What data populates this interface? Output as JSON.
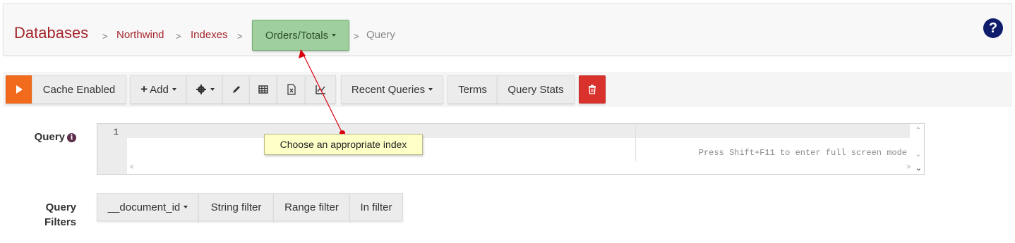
{
  "breadcrumb": {
    "databases": "Databases",
    "sep": ">",
    "database": "Northwind",
    "indexes": "Indexes",
    "index": "Orders/Totals",
    "query": "Query"
  },
  "help_icon": "question-circle-icon",
  "toolbar": {
    "play_icon": "play-icon",
    "cache": "Cache Enabled",
    "add": "Add",
    "recent": "Recent Queries",
    "terms": "Terms",
    "stats": "Query Stats"
  },
  "query": {
    "label": "Query",
    "info": "i",
    "line_number": "1",
    "hint": "Press Shift+F11 to enter full screen mode"
  },
  "tooltip": "Choose an appropriate index",
  "filters": {
    "label_line1": "Query",
    "label_line2": "Filters",
    "field": "__document_id",
    "string": "String filter",
    "range": "Range filter",
    "in": "In filter"
  },
  "colors": {
    "accent": "#a4262c",
    "index_button": "#9fcf9f",
    "play": "#f26b1d",
    "delete": "#d9322d",
    "annotation": "#d9000d"
  }
}
